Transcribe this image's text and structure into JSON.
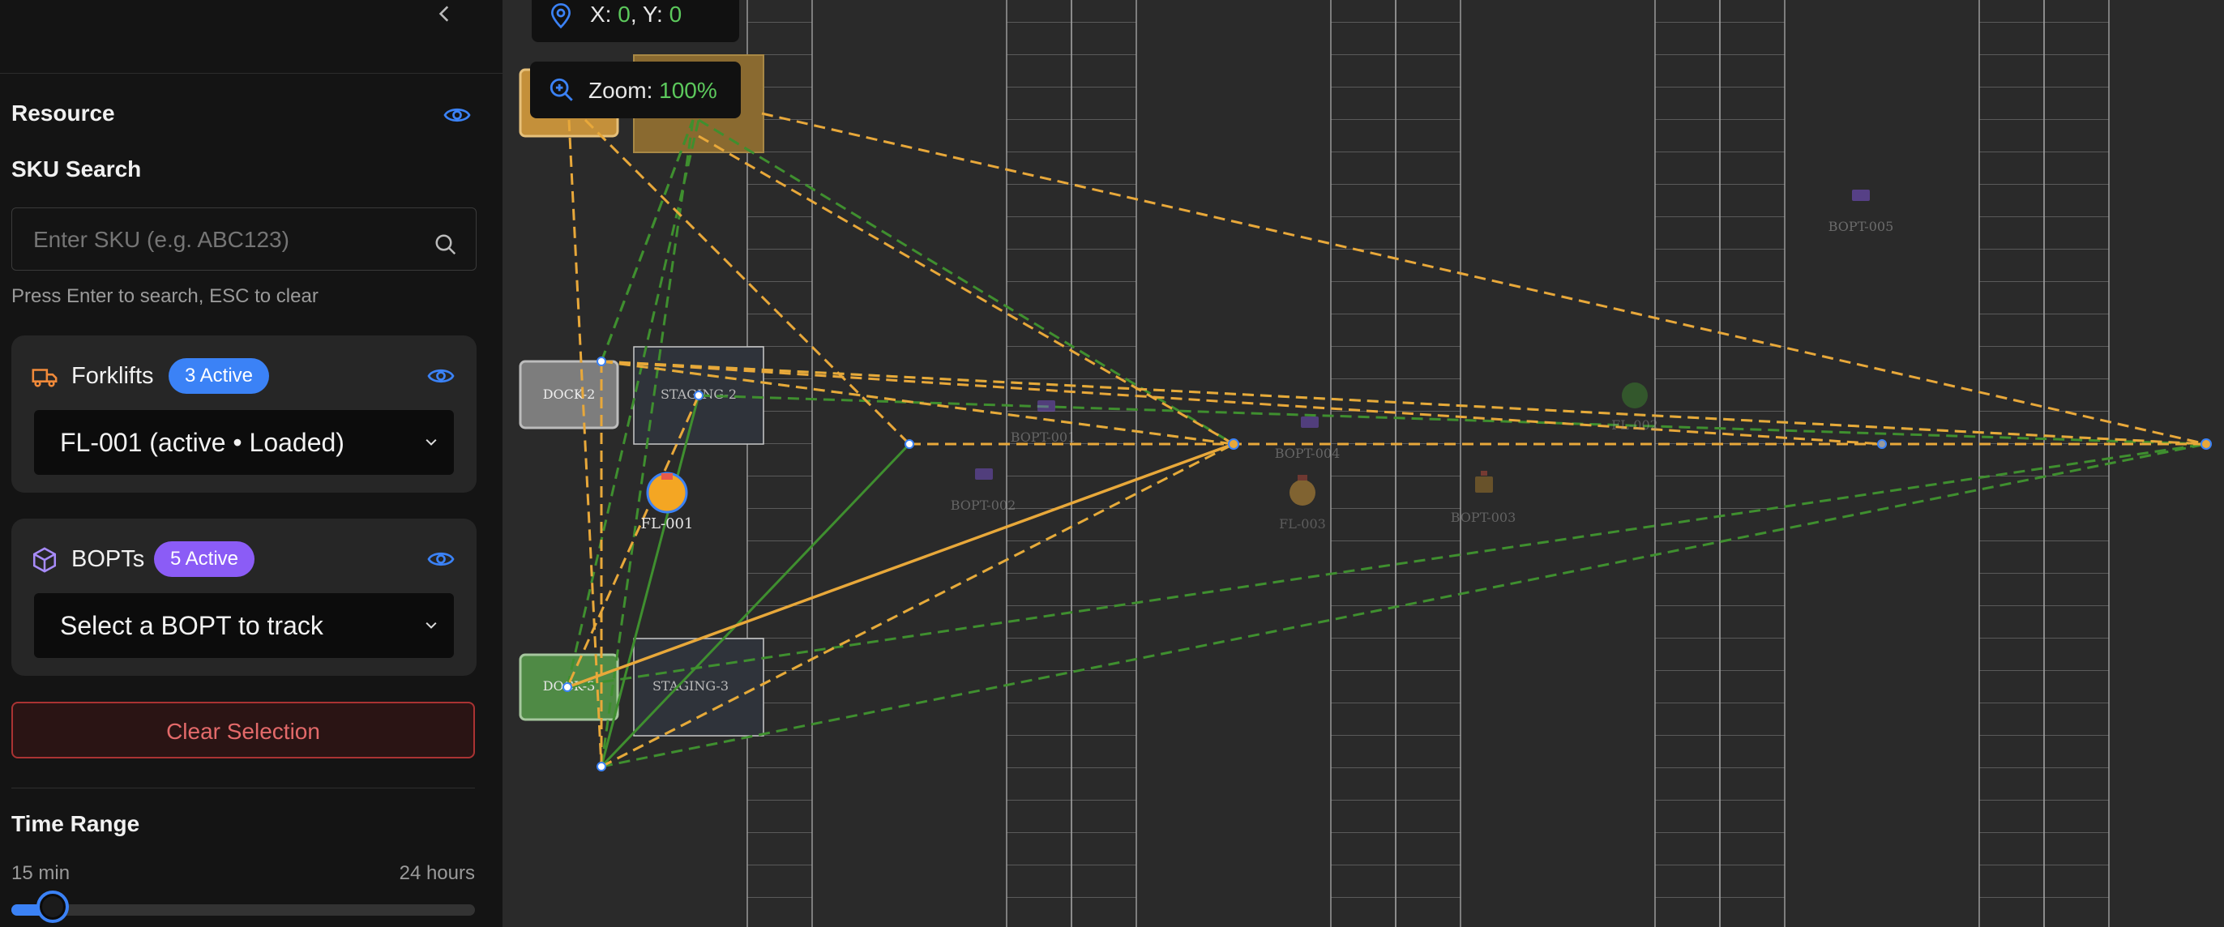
{
  "sidebar": {
    "collapse_icon": "chevron-left-icon",
    "resource_title": "Resource",
    "sku": {
      "title": "SKU Search",
      "placeholder": "Enter SKU (e.g. ABC123)",
      "hint": "Press Enter to search, ESC to clear"
    },
    "forklifts": {
      "title": "Forklifts",
      "badge": "3 Active",
      "selected": "FL-001 (active • Loaded)"
    },
    "bopts": {
      "title": "BOPTs",
      "badge": "5 Active",
      "selected": "Select a BOPT to track"
    },
    "clear_button": "Clear Selection",
    "time_range": {
      "title": "Time Range",
      "min_label": "15 min",
      "max_label": "24 hours",
      "slider_value": 0.09
    }
  },
  "map": {
    "coords": {
      "x_label": "X:",
      "x_value": "0",
      "sep": ",",
      "y_label": "Y:",
      "y_value": "0"
    },
    "zoom": {
      "label": "Zoom:",
      "value": "100%"
    },
    "zones": {
      "dock2": "DOCK-2",
      "staging2": "STAGING-2",
      "dock3": "DOCK-3",
      "staging3": "STAGING-3"
    },
    "forklift_labels": {
      "fl001": "FL-001",
      "fl002": "FL-002",
      "fl003": "FL-003"
    },
    "bopt_labels": {
      "b1": "BOPT-001",
      "b2": "BOPT-002",
      "b3": "BOPT-003",
      "b4": "BOPT-004",
      "b5": "BOPT-005"
    }
  },
  "colors": {
    "accent_blue": "#3b82f6",
    "orange_route": "#e8a83a",
    "green_route": "#3f8f2f",
    "purple_badge": "#8b5cf6",
    "danger": "#e05a5a"
  }
}
